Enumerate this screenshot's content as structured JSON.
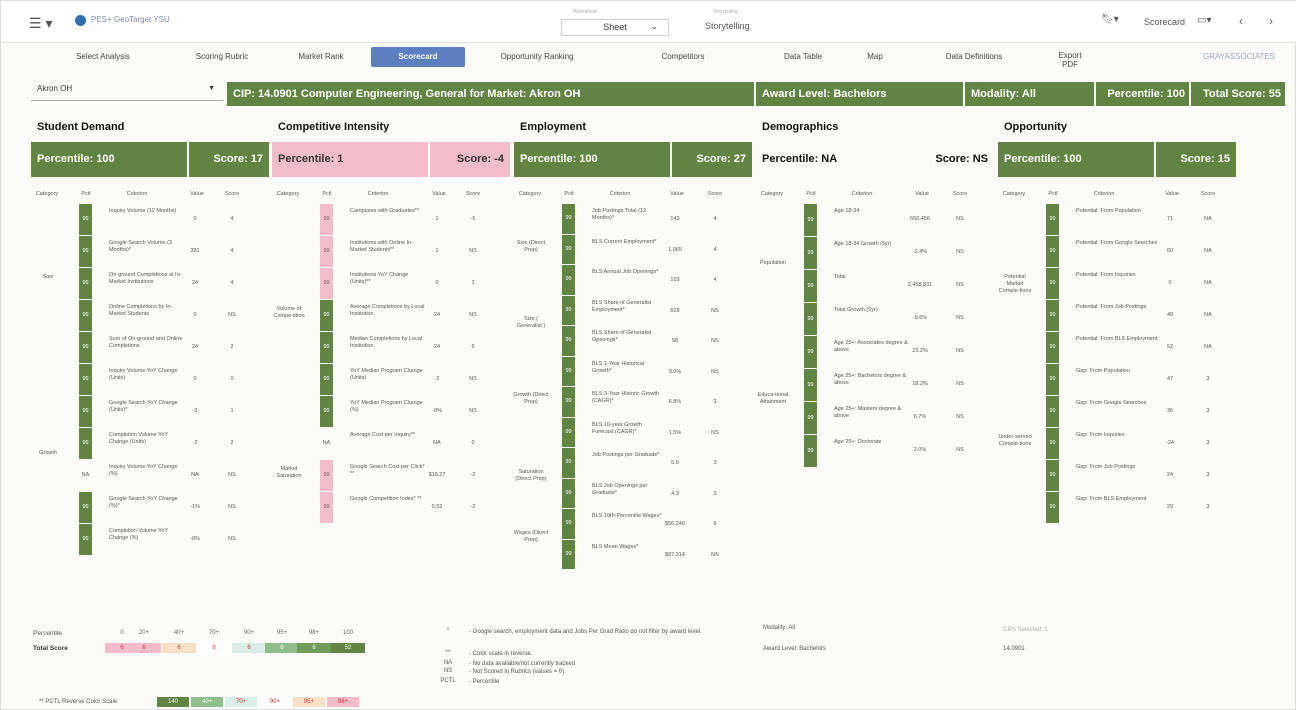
{
  "app": {
    "title": "PES+ GeoTarget YSU",
    "worksheet_small": "Worksheet",
    "worksheet": "Sheet",
    "storytelling_small": "Storytelling",
    "storytelling": "Storytelling",
    "scorecard_btn": "Scorecard"
  },
  "nav": {
    "items": [
      "Select Analysis",
      "Scoring Rubric",
      "Market Rank",
      "Opportunity Ranking",
      "Competitors",
      "Data Table",
      "Map",
      "Data Definitions",
      "Export PDF"
    ],
    "selected": "Scorecard",
    "brand": "GRAYASSOCIATES"
  },
  "filter": {
    "market": "Akron OH"
  },
  "banner": {
    "title": "CIP: 14.0901 Computer Engineering, General for Market: Akron OH",
    "award": "Award Level: Bachelors",
    "modality": "Modality: All",
    "percentile": "Percentile: 100",
    "total": "Total Score: 55"
  },
  "sections": {
    "student": {
      "title": "Student Demand",
      "percentile": "Percentile: 100",
      "score": "Score: 17",
      "cats": [
        {
          "name": "Size"
        },
        {
          "name": "Growth"
        }
      ],
      "rows": [
        {
          "pct": "99",
          "crit": "Inquiry Volume (12 Months)",
          "val": "0",
          "score": "4"
        },
        {
          "pct": "99",
          "crit": "Google Search Volume (3 Months)*",
          "val": "381",
          "score": "4"
        },
        {
          "pct": "99",
          "crit": "On-ground Completions at In-Market Institutions",
          "val": "24",
          "score": "4"
        },
        {
          "pct": "99",
          "crit": "Online Completions by In-Market Students",
          "val": "0",
          "score": "NS"
        },
        {
          "pct": "99",
          "crit": "Sum of On-ground and Online Completions",
          "val": "24",
          "score": "2"
        },
        {
          "pct": "99",
          "crit": "Inquiry Volume YoY Change (Units)",
          "val": "0",
          "score": "0"
        },
        {
          "pct": "99",
          "crit": "Google Search YoY Change (Units)*",
          "val": "-3",
          "score": "1"
        },
        {
          "pct": "99",
          "crit": "Completion Volume YoY Change (Units)",
          "val": "-2",
          "score": "2"
        },
        {
          "pct": "NA",
          "crit": "Inquiry Volume YoY Change (%)",
          "val": "NA",
          "score": "NS"
        },
        {
          "pct": "99",
          "crit": "Google Search YoY Change (%)*",
          "val": "-1%",
          "score": "NS"
        },
        {
          "pct": "99",
          "crit": "Completion Volume YoY Change (%)",
          "val": "-8%",
          "score": "NS"
        }
      ]
    },
    "competitive": {
      "title": "Competitive Intensity",
      "percentile": "Percentile: 1",
      "score": "Score: -4",
      "cats": [
        {
          "name": "Volume of Compe-tition"
        },
        {
          "name": "Market Saturation"
        }
      ],
      "rows": [
        {
          "pct": "99",
          "crit": "Campuses with Graduates**",
          "val": "1",
          "score": "-5"
        },
        {
          "pct": "99",
          "crit": "Institutions with Online In-Market Students**",
          "val": "1",
          "score": "NS"
        },
        {
          "pct": "99",
          "crit": "Institutions YoY Change (Units)**",
          "val": "0",
          "score": "1"
        },
        {
          "pct": "99",
          "crit": "Average Completions by Local Institution",
          "val": "24",
          "score": "NS"
        },
        {
          "pct": "99",
          "crit": "Median Completions by Local Institution",
          "val": "24",
          "score": "6"
        },
        {
          "pct": "99",
          "crit": "YoY Median Program Change (Units)",
          "val": "-2",
          "score": "NS"
        },
        {
          "pct": "99",
          "crit": "YoY Median Program Change (%)",
          "val": "-8%",
          "score": "NS"
        },
        {
          "pct": "NA",
          "crit": "Average Cost per Inquiry**",
          "val": "NA",
          "score": "0"
        },
        {
          "pct": "99",
          "crit": "Google Search Cost per Click* **",
          "val": "$18.27",
          "score": "-2"
        },
        {
          "pct": "99",
          "crit": "Google Competition Index* **",
          "val": "0.52",
          "score": "-2"
        }
      ]
    },
    "employment": {
      "title": "Employment",
      "percentile": "Percentile: 100",
      "score": "Score: 27",
      "cats": [
        {
          "name": "Size (Direct Prep)"
        },
        {
          "name": "Size ( Generalist )"
        },
        {
          "name": "Growth (Direct Prep)"
        },
        {
          "name": "Saturation (Direct Prep)"
        },
        {
          "name": "Wages (Direct Prep)"
        }
      ],
      "rows": [
        {
          "pct": "99",
          "crit": "Job Postings Total (12 Months)*",
          "val": "143",
          "score": "4"
        },
        {
          "pct": "99",
          "crit": "BLS Current Employment*",
          "val": "1,065",
          "score": "4"
        },
        {
          "pct": "99",
          "crit": "BLS Annual Job Openings*",
          "val": "103",
          "score": "4"
        },
        {
          "pct": "99",
          "crit": "BLS Share of Generalist Employment*",
          "val": "628",
          "score": "NS"
        },
        {
          "pct": "99",
          "crit": "BLS Share of Generalist Openings*",
          "val": "58",
          "score": "NS"
        },
        {
          "pct": "99",
          "crit": "BLS 1-Year Historical Growth*",
          "val": "9.0%",
          "score": "NS"
        },
        {
          "pct": "99",
          "crit": "BLS 3-Year Historic Growth (CAGR)*",
          "val": "6.8%",
          "score": "3"
        },
        {
          "pct": "99",
          "crit": "BLS 10-year Growth Forecast (CAGR)*",
          "val": "1.5%",
          "score": "NS"
        },
        {
          "pct": "99",
          "crit": "Job Postings per Graduate*",
          "val": "5.9",
          "score": "3"
        },
        {
          "pct": "99",
          "crit": "BLS Job Openings per Graduate*",
          "val": "4.3",
          "score": "3"
        },
        {
          "pct": "99",
          "crit": "BLS 10th-Percentile Wages*",
          "val": "$56,246",
          "score": "6"
        },
        {
          "pct": "99",
          "crit": "BLS Mean Wages*",
          "val": "$87,214",
          "score": "NS"
        }
      ]
    },
    "demographics": {
      "title": "Demographics",
      "percentile": "Percentile: NA",
      "score": "Score: NS",
      "cats": [
        {
          "name": "Population"
        },
        {
          "name": "Educa-tional Attainment"
        }
      ],
      "rows": [
        {
          "pct": "99",
          "crit": "Age 18-34",
          "val": "550,456",
          "score": "NS"
        },
        {
          "pct": "99",
          "crit": "Age 18-34 Growth (5yr)",
          "val": "-2.4%",
          "score": "NS"
        },
        {
          "pct": "99",
          "crit": "Total",
          "val": "2,458,831",
          "score": "NS"
        },
        {
          "pct": "99",
          "crit": "Total Growth (5yr)",
          "val": "-0.6%",
          "score": "NS"
        },
        {
          "pct": "99",
          "crit": "Age 25+: Associates degree & above",
          "val": "23.2%",
          "score": "NS"
        },
        {
          "pct": "99",
          "crit": "Age 25+: Bachelors degree & above",
          "val": "18.2%",
          "score": "NS"
        },
        {
          "pct": "99",
          "crit": "Age 25+: Masters degree & above",
          "val": "6.7%",
          "score": "NS"
        },
        {
          "pct": "99",
          "crit": "Age 25+: Doctorate",
          "val": "2.0%",
          "score": "NS"
        }
      ]
    },
    "opportunity": {
      "title": "Opportunity",
      "percentile": "Percentile: 100",
      "score": "Score: 15",
      "cats": [
        {
          "name": "Potential Market Comple-tions"
        },
        {
          "name": "Under-served Comple-tions"
        }
      ],
      "rows": [
        {
          "pct": "99",
          "crit": "Potential: From Population",
          "val": "71",
          "score": "NA"
        },
        {
          "pct": "99",
          "crit": "Potential: From Google Searches",
          "val": "60",
          "score": "NA"
        },
        {
          "pct": "99",
          "crit": "Potential: From Inquiries",
          "val": "0",
          "score": "NA"
        },
        {
          "pct": "99",
          "crit": "Potential: From Job Postings",
          "val": "48",
          "score": "NA"
        },
        {
          "pct": "99",
          "crit": "Potential: From BLS Employment",
          "val": "52",
          "score": "NA"
        },
        {
          "pct": "99",
          "crit": "Gap: From Population",
          "val": "47",
          "score": "3"
        },
        {
          "pct": "99",
          "crit": "Gap: From Google Searches",
          "val": "36",
          "score": "3"
        },
        {
          "pct": "99",
          "crit": "Gap: From Inquiries",
          "val": "-24",
          "score": "3"
        },
        {
          "pct": "99",
          "crit": "Gap: From Job Postings",
          "val": "24",
          "score": "3"
        },
        {
          "pct": "99",
          "crit": "Gap: From BLS Employment",
          "val": "29",
          "score": "3"
        }
      ]
    }
  },
  "table_headers": {
    "category": "Category",
    "pctl": "Pctl",
    "criterion": "Criterion",
    "value": "Value",
    "score": "Score"
  },
  "legend": {
    "percentile_label": "Percentile",
    "total_label": "Total Score",
    "pct_values": [
      "0",
      "20+",
      "40+",
      "70+",
      "90+",
      "95+",
      "98+",
      "100"
    ],
    "total_values": [
      "6",
      "6",
      "6",
      "6",
      "6",
      "6",
      "6",
      "52"
    ],
    "reverse_label": "** PCTL Reverse Color Scale",
    "reverse_values": [
      "140",
      "40+",
      "70+",
      "90+",
      "95+",
      "98+"
    ],
    "notes": [
      {
        "k": "*",
        "v": "- Google search, employment data and Jobs Per Grad Ratio do not filter by award level."
      },
      {
        "k": "**",
        "v": "- Color scale in reverse."
      },
      {
        "k": "NA",
        "v": "- No data available/not currently tracked"
      },
      {
        "k": "NS",
        "v": "- Not Scored in Rubrics (values = 0)."
      },
      {
        "k": "PCTL",
        "v": "- Percentile"
      }
    ],
    "modality": "Modality: All",
    "award": "Award Level: Bachelors",
    "cips_label": "CIPs Selected: 1",
    "cip": "14.0901"
  },
  "colors": {
    "green": "#628443",
    "pink": "#f3bccb",
    "blue": "#5b7fc0"
  }
}
